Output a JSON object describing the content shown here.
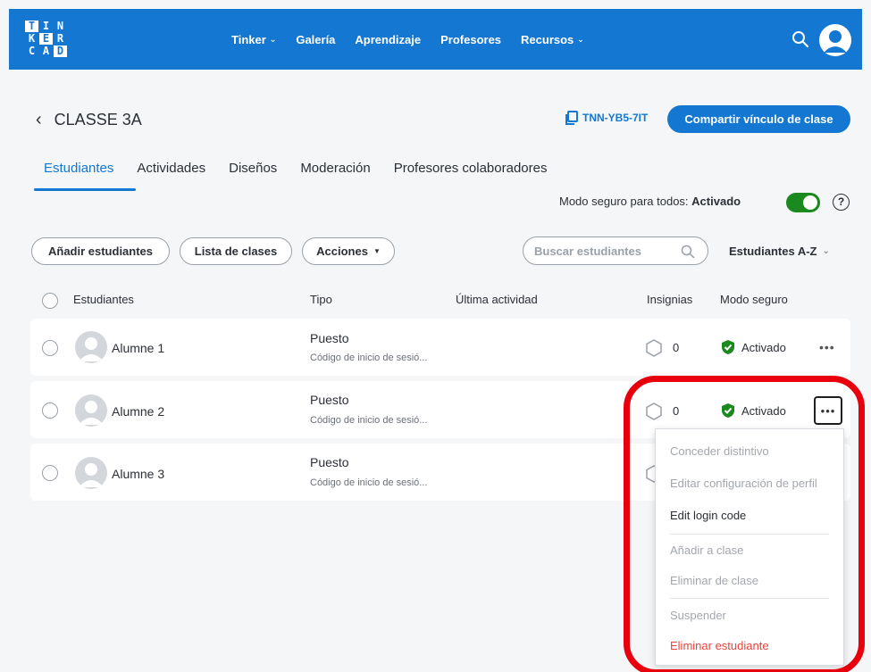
{
  "header": {
    "logo_letters": [
      "T",
      "I",
      "N",
      "K",
      "E",
      "R",
      "C",
      "A",
      "D"
    ],
    "nav": [
      {
        "label": "Tinker",
        "has_dropdown": true
      },
      {
        "label": "Galería",
        "has_dropdown": false
      },
      {
        "label": "Aprendizaje",
        "has_dropdown": false
      },
      {
        "label": "Profesores",
        "has_dropdown": false
      },
      {
        "label": "Recursos",
        "has_dropdown": true
      }
    ],
    "brand_color": "#1477d1"
  },
  "class": {
    "title": "CLASSE 3A",
    "code": "TNN-YB5-7IT",
    "share_label": "Compartir vínculo de clase"
  },
  "tabs": [
    {
      "label": "Estudiantes",
      "active": true
    },
    {
      "label": "Actividades",
      "active": false
    },
    {
      "label": "Diseños",
      "active": false
    },
    {
      "label": "Moderación",
      "active": false
    },
    {
      "label": "Profesores colaboradores",
      "active": false
    }
  ],
  "safe_mode": {
    "label": "Modo seguro para todos:",
    "value": "Activado",
    "on": true
  },
  "toolbar": {
    "add_students": "Añadir estudiantes",
    "class_list": "Lista de clases",
    "actions": "Acciones",
    "search_placeholder": "Buscar estudiantes",
    "sort": "Estudiantes A-Z"
  },
  "table": {
    "headers": {
      "students": "Estudiantes",
      "type": "Tipo",
      "last_activity": "Última actividad",
      "badges": "Insignias",
      "safe_mode": "Modo seguro"
    },
    "rows": [
      {
        "name": "Alumne 1",
        "type": "Puesto",
        "type_sub": "Código de inicio de sesió...",
        "badges": "0",
        "safe": "Activado"
      },
      {
        "name": "Alumne 2",
        "type": "Puesto",
        "type_sub": "Código de inicio de sesió...",
        "badges": "0",
        "safe": "Activado"
      },
      {
        "name": "Alumne 3",
        "type": "Puesto",
        "type_sub": "Código de inicio de sesió...",
        "badges": "",
        "safe": ""
      }
    ]
  },
  "menu": {
    "items": [
      {
        "label": "Conceder distintivo",
        "state": "disabled"
      },
      {
        "label": "Editar configuración de perfil",
        "state": "disabled"
      },
      {
        "label": "Edit login code",
        "state": "enabled"
      },
      {
        "label": "Añadir a clase",
        "state": "disabled"
      },
      {
        "label": "Eliminar de clase",
        "state": "disabled"
      },
      {
        "label": "Suspender",
        "state": "disabled"
      },
      {
        "label": "Eliminar estudiante",
        "state": "danger"
      }
    ]
  },
  "colors": {
    "accent": "#1477d1",
    "toggle_on": "#1a8a1f",
    "safe_check": "#1a8a1f",
    "danger": "#e8443c",
    "highlight_ring": "#e8000c"
  }
}
